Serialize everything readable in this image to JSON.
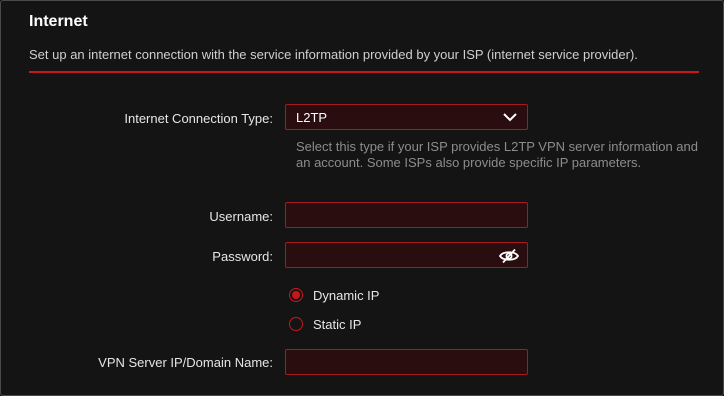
{
  "section": {
    "title": "Internet",
    "description": "Set up an internet connection with the service information provided by your ISP (internet service provider)."
  },
  "connection_type": {
    "label": "Internet Connection Type:",
    "value": "L2TP",
    "help": "Select this type if your ISP provides L2TP VPN server information and an account. Some ISPs also provide specific IP parameters."
  },
  "username": {
    "label": "Username:",
    "value": ""
  },
  "password": {
    "label": "Password:",
    "value": "",
    "visibility_icon": "eye-slash-icon"
  },
  "ip_mode": {
    "options": [
      {
        "label": "Dynamic IP",
        "selected": true
      },
      {
        "label": "Static IP",
        "selected": false
      }
    ]
  },
  "vpn_server": {
    "label": "VPN Server IP/Domain Name:",
    "value": ""
  },
  "colors": {
    "accent": "#c8161d",
    "field_bg": "#2a0d0f",
    "background": "#141414"
  }
}
